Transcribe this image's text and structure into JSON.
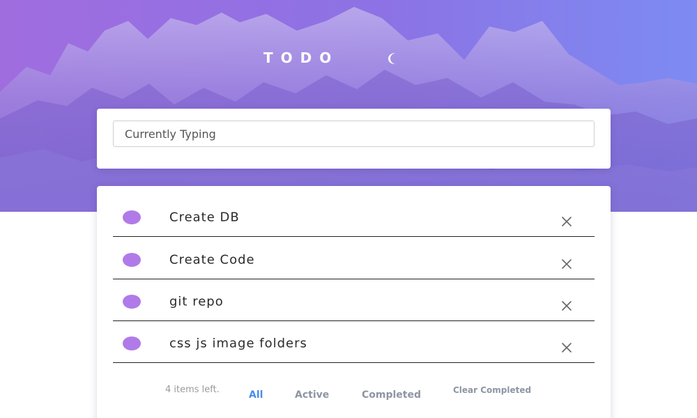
{
  "header": {
    "title": "TODO",
    "theme_toggle_icon": "moon-icon"
  },
  "input": {
    "value": "Currently Typing",
    "placeholder": ""
  },
  "todos": [
    {
      "text": "Create DB",
      "completed": false,
      "check_icon": "circle-icon",
      "delete_icon": "close-icon"
    },
    {
      "text": "Create Code",
      "completed": false,
      "check_icon": "circle-icon",
      "delete_icon": "close-icon"
    },
    {
      "text": "git repo",
      "completed": false,
      "check_icon": "circle-icon",
      "delete_icon": "close-icon"
    },
    {
      "text": "css js image folders",
      "completed": false,
      "check_icon": "circle-icon",
      "delete_icon": "close-icon"
    }
  ],
  "footer": {
    "items_left": "4 items left.",
    "filters": [
      {
        "label": "All",
        "selected": true
      },
      {
        "label": "Active",
        "selected": false
      },
      {
        "label": "Completed",
        "selected": false
      }
    ],
    "clear_completed": "Clear Completed"
  },
  "colors": {
    "accent": "#4a8de8",
    "check": "#b07be8",
    "hero_start": "#9b6fe0",
    "hero_end": "#7f86f0",
    "muted": "#8d95a3"
  }
}
